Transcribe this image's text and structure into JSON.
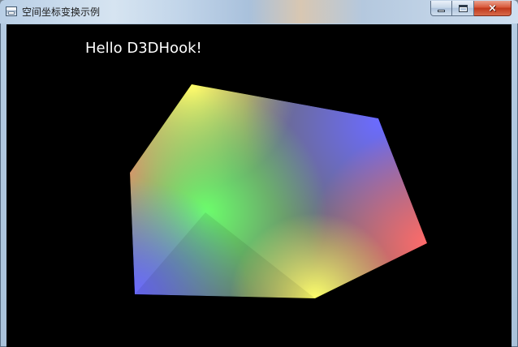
{
  "window": {
    "title": "空间坐标变换示例",
    "icon": "application-window-icon",
    "controls": {
      "minimize": "minimize-icon",
      "maximize": "maximize-icon",
      "close": "×"
    }
  },
  "client": {
    "background": "#000000",
    "overlay_text": "Hello D3DHook!",
    "scene": {
      "object": "rotating-rgb-cube",
      "vertex_colors": {
        "top": "#ffff00",
        "upper_left": "#ff0000",
        "upper_right": "#0000ff",
        "right": "#ff0000",
        "center": "#00ff00",
        "lower_left": "#0000ff",
        "bottom": "#ffff00"
      }
    }
  }
}
